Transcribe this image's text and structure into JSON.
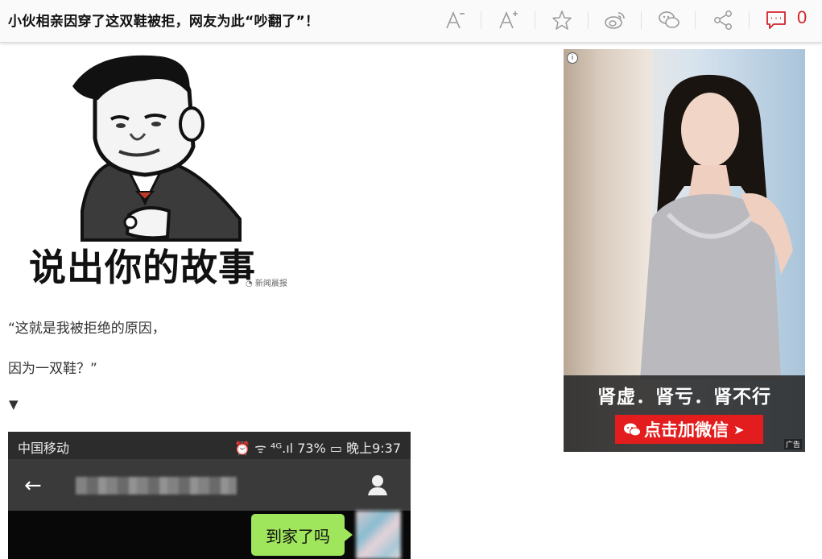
{
  "header": {
    "title": "小伙相亲因穿了这双鞋被拒，网友为此“吵翻了”！",
    "comment_count": "0",
    "tools": [
      "font-decrease-icon",
      "font-increase-icon",
      "star-icon",
      "weibo-icon",
      "wechat-icon",
      "share-icon",
      "comment-icon"
    ]
  },
  "article": {
    "meme_caption": "说出你的故事",
    "watermark": "新闻晨报",
    "quote_line1": "“这就是我被拒绝的原因，",
    "quote_line2": "因为一双鞋？”",
    "marker": "▼",
    "phone": {
      "carrier": "中国移动",
      "status": "⏰ ᯤ ⁴ᴳ.ıl 73% ▭ 晚上9:37",
      "back": "←",
      "bubble_text": "到家了吗"
    }
  },
  "ad": {
    "headline": "肾虚．肾亏．肾不行",
    "cta": "点击加微信",
    "cta_arrow": "➤",
    "label": "广告",
    "info": "i"
  },
  "colors": {
    "accent_red": "#d2232a",
    "cta_red": "#e31d1d",
    "bubble_green": "#9fe65c"
  }
}
